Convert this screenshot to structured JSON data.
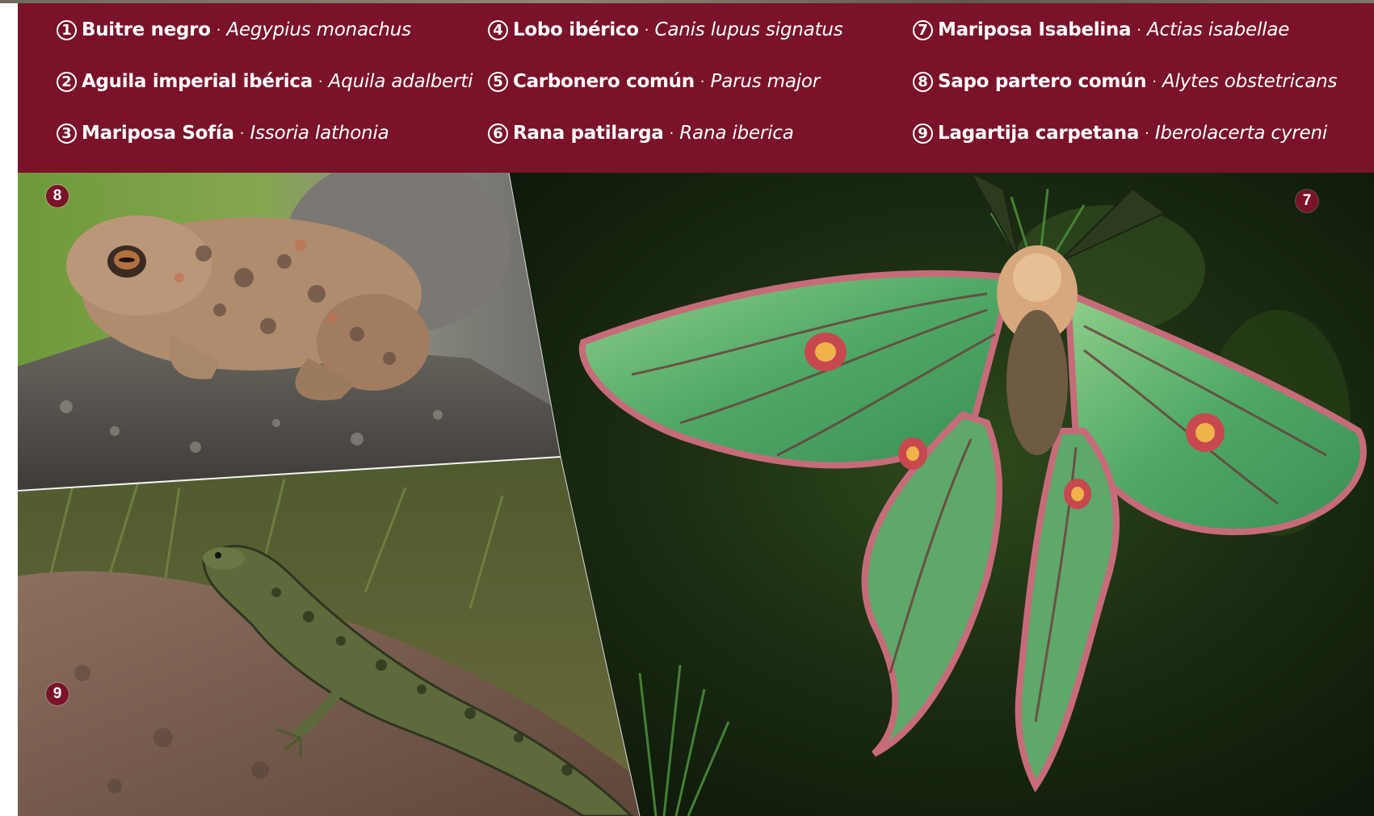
{
  "legend": [
    {
      "num": "1",
      "common": "Buitre negro",
      "scientific": "Aegypius monachus"
    },
    {
      "num": "2",
      "common": "Aguila imperial ibérica",
      "scientific": "Aquila adalberti"
    },
    {
      "num": "3",
      "common": "Mariposa Sofía",
      "scientific": "Issoria lathonia"
    },
    {
      "num": "4",
      "common": "Lobo ibérico",
      "scientific": "Canis lupus signatus"
    },
    {
      "num": "5",
      "common": "Carbonero común",
      "scientific": "Parus major"
    },
    {
      "num": "6",
      "common": "Rana patilarga",
      "scientific": "Rana iberica"
    },
    {
      "num": "7",
      "common": "Mariposa Isabelina",
      "scientific": "Actias isabellae"
    },
    {
      "num": "8",
      "common": "Sapo partero común",
      "scientific": "Alytes obstetricans"
    },
    {
      "num": "9",
      "common": "Lagartija carpetana",
      "scientific": "Iberolacerta cyreni"
    }
  ],
  "separator": "·",
  "photos": {
    "toad_marker": "8",
    "lizard_marker": "9",
    "moth_marker": "7"
  },
  "colors": {
    "band": "#7a1229",
    "text": "#ffffff"
  }
}
